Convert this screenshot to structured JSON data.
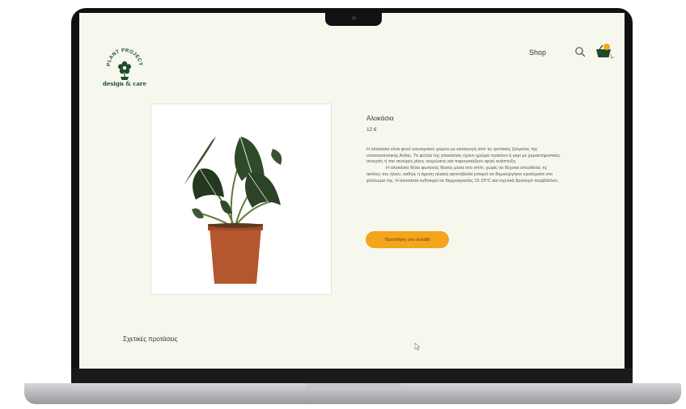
{
  "header": {
    "logo": {
      "arc_text": "PLANT PROJECTS",
      "subtitle": "design & care"
    },
    "nav": {
      "shop_label": "Shop"
    },
    "cart_count": ""
  },
  "product": {
    "title": "Αλοκάσια",
    "price": "12 €",
    "description_p1": "Η αλοκάσια είναι φυτό εσωτερικού χώρου με καταγωγή από τις τροπικές ζούγκλες της νοτιοανατολικής Ασίας. Τα φύλλα της αλοκάσιας έχουν χρώμα πράσινο ή γκρι με χαρακτηριστικές ανοιχτές ή πιο σκούρες ρίγες νευρώσεις και παρουσιάζουν αργή ανάπτυξη.",
    "description_p2": "Η αλοκάσια θέλει φωτεινές θέσεις μέσα στο σπίτι, χωρίς να δέχεται απευθείας τις ακτίνες του ήλιου, καθώς η άμεση ηλιακή ακτινοβολία μπορεί να δημιουργήσει εγκαύματα στο φύλλωμα της. Η αλοκάσια ευδοκιμεί σε θερμοκρασίες 15-25°C και σχετικά δροσερό περιβάλλον.",
    "add_to_cart_label": "Προσθήκη στο καλάθι"
  },
  "related": {
    "heading": "Σχετικές προτάσεις"
  },
  "colors": {
    "page_bg": "#f6f8ee",
    "accent": "#f4a51c",
    "brand_green": "#1e4a2c"
  },
  "icons": [
    "flower-logo-icon",
    "search-icon",
    "shopping-basket-icon",
    "mouse-cursor-icon"
  ]
}
